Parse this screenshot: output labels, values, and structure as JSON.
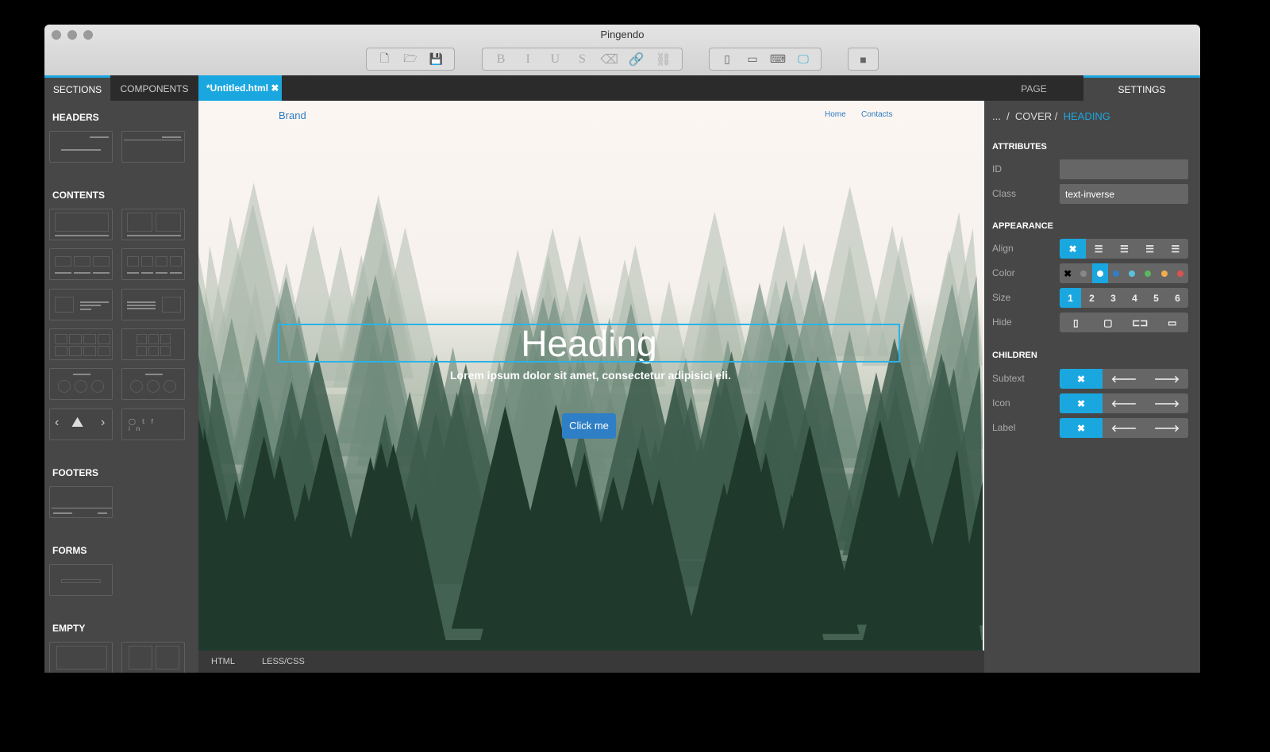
{
  "window": {
    "title": "Pingendo"
  },
  "toolbar": {
    "file": [
      {
        "icon": "new-file-icon",
        "glyph": "🗋"
      },
      {
        "icon": "open-folder-icon",
        "glyph": "🗁"
      },
      {
        "icon": "save-icon",
        "glyph": "💾"
      }
    ],
    "format": [
      {
        "icon": "bold-icon",
        "glyph": "B"
      },
      {
        "icon": "italic-icon",
        "glyph": "I"
      },
      {
        "icon": "underline-icon",
        "glyph": "U"
      },
      {
        "icon": "strikethrough-icon",
        "glyph": "S"
      },
      {
        "icon": "eraser-icon",
        "glyph": "⌫"
      },
      {
        "icon": "link-icon",
        "glyph": "🔗"
      },
      {
        "icon": "unlink-icon",
        "glyph": "⛓"
      }
    ],
    "devices": [
      {
        "icon": "phone-icon",
        "glyph": "▯"
      },
      {
        "icon": "tablet-icon",
        "glyph": "▭"
      },
      {
        "icon": "laptop-icon",
        "glyph": "⌨"
      },
      {
        "icon": "desktop-icon",
        "glyph": "🖵",
        "active": true
      }
    ],
    "folder": {
      "icon": "folder-icon",
      "glyph": "■"
    }
  },
  "left_tabs": [
    "SECTIONS",
    "COMPONENTS"
  ],
  "file_tab": {
    "label": "*Untitled.html",
    "close": "✖"
  },
  "sidebar": {
    "sections": [
      "HEADERS",
      "CONTENTS",
      "FOOTERS",
      "FORMS",
      "EMPTY"
    ]
  },
  "page": {
    "brand": "Brand",
    "nav": [
      "Home",
      "Contacts"
    ],
    "heading": "Heading",
    "subtext": "Lorem ipsum dolor sit amet, consectetur adipisici eli.",
    "button": "Click me"
  },
  "bottom_tabs": [
    "HTML",
    "LESS/CSS"
  ],
  "right_tabs": [
    "PAGE",
    "SETTINGS"
  ],
  "breadcrumb": [
    "...",
    "COVER",
    "HEADING"
  ],
  "attributes": {
    "title": "ATTRIBUTES",
    "id_label": "ID",
    "id_value": "",
    "class_label": "Class",
    "class_value": "text-inverse"
  },
  "appearance": {
    "title": "APPEARANCE",
    "align_label": "Align",
    "color_label": "Color",
    "size_label": "Size",
    "hide_label": "Hide",
    "sizes": [
      "1",
      "2",
      "3",
      "4",
      "5",
      "6"
    ],
    "selected_size": "1",
    "colors": [
      "#888888",
      "#ffffff",
      "#2f7fc6",
      "#5bc0de",
      "#5cb85c",
      "#f0ad4e",
      "#d9534f"
    ],
    "selected_color": "#ffffff",
    "accent": "#1aa7e0"
  },
  "children": {
    "title": "CHILDREN",
    "items": [
      "Subtext",
      "Icon",
      "Label"
    ]
  }
}
